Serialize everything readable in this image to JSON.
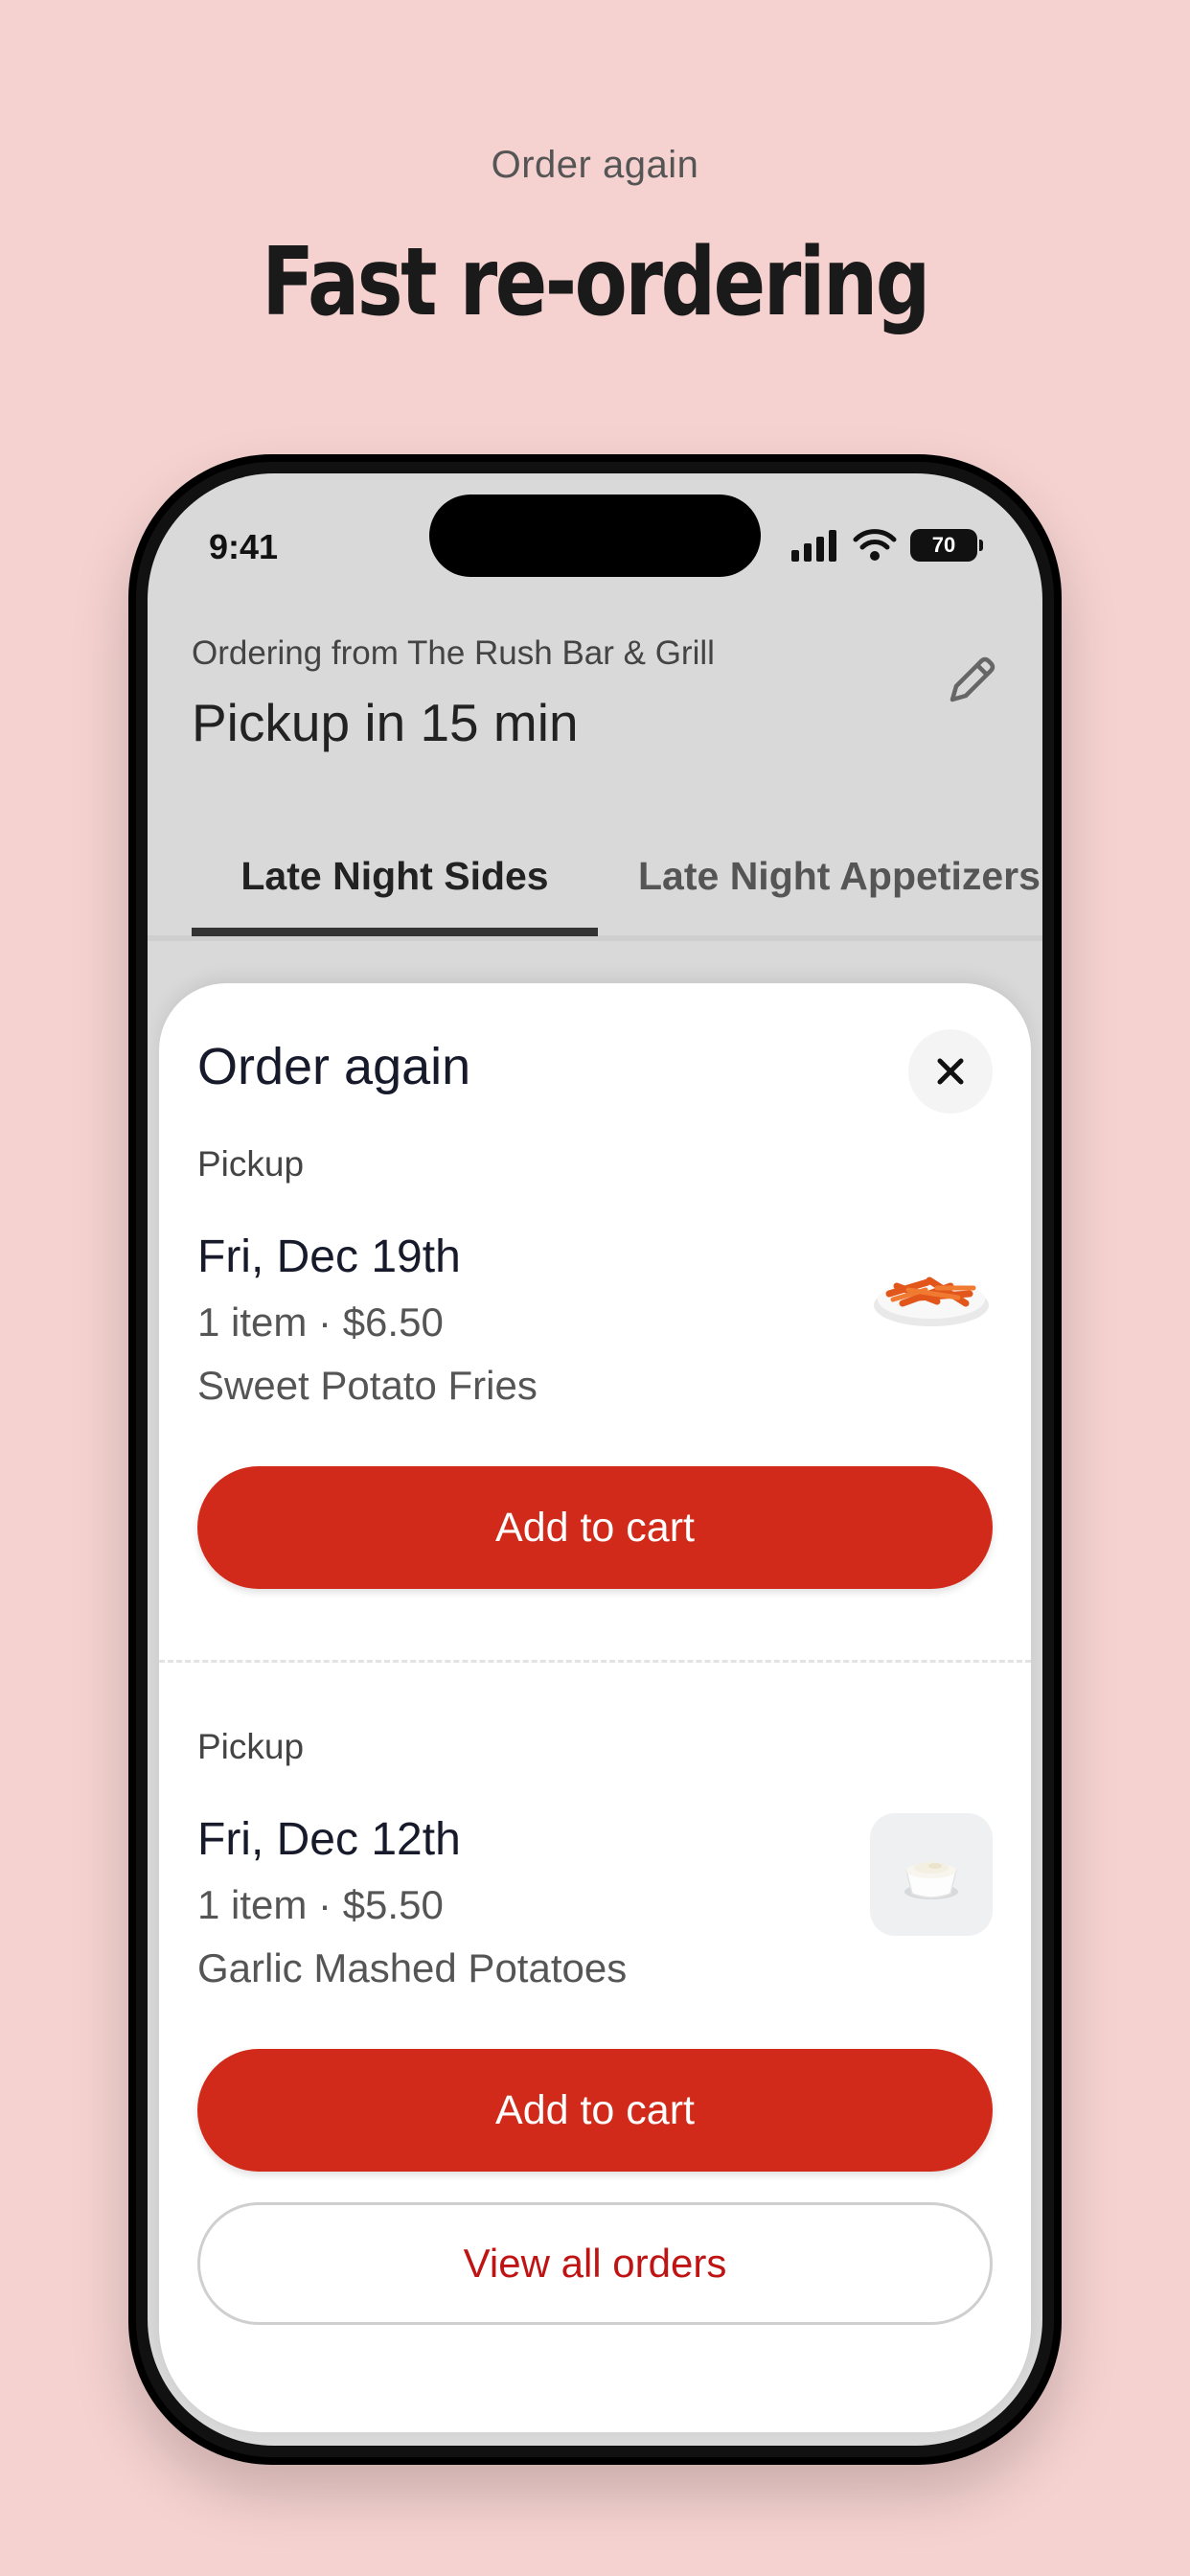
{
  "promo": {
    "eyebrow": "Order again",
    "headline": "Fast re-ordering"
  },
  "status_bar": {
    "time": "9:41",
    "battery": "70"
  },
  "header": {
    "store_line": "Ordering from The Rush Bar & Grill",
    "pickup_line": "Pickup in 15 min",
    "edit_icon": "pencil-icon"
  },
  "tabs": [
    {
      "label": "Late Night Sides",
      "selected": true
    },
    {
      "label": "Late Night Appetizers",
      "selected": false
    }
  ],
  "sheet": {
    "title": "Order again",
    "close_icon": "close-icon",
    "orders": [
      {
        "mode": "Pickup",
        "date": "Fri, Dec 19th",
        "meta": "1 item · $6.50",
        "item": "Sweet Potato Fries",
        "thumb": "sweet-potato-fries-image",
        "button": "Add to cart"
      },
      {
        "mode": "Pickup",
        "date": "Fri, Dec 12th",
        "meta": "1 item · $5.50",
        "item": "Garlic Mashed Potatoes",
        "thumb": "garlic-mashed-potatoes-image",
        "button": "Add to cart"
      }
    ],
    "view_all": "View all orders"
  },
  "colors": {
    "background": "#f5d2d0",
    "primary": "#d22a1a",
    "link": "#c01414"
  }
}
